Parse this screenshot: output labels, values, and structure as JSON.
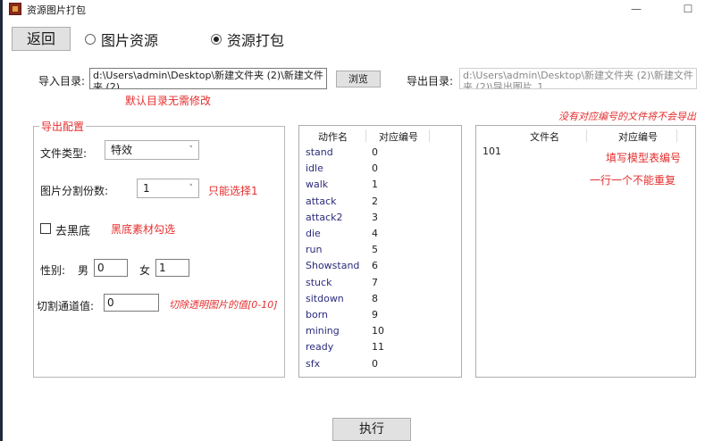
{
  "window": {
    "title": "资源图片打包",
    "minimize_glyph": "—",
    "maximize_glyph": "☐"
  },
  "top": {
    "back_label": "返回",
    "mode_options": [
      {
        "label": "图片资源",
        "selected": false
      },
      {
        "label": "资源打包",
        "selected": true
      }
    ]
  },
  "import": {
    "label": "导入目录:",
    "value": "d:\\Users\\admin\\Desktop\\新建文件夹 (2)\\新建文件夹 (2)",
    "browse_label": "浏览",
    "hint": "默认目录无需修改"
  },
  "export": {
    "label": "导出目录:",
    "value": "d:\\Users\\admin\\Desktop\\新建文件夹 (2)\\新建文件夹 (2)\\导出图片_1",
    "hint": "没有对应编号的文件将不会导出"
  },
  "config": {
    "group_title": "导出配置",
    "file_type_label": "文件类型:",
    "file_type_value": "特效",
    "split_label": "图片分割份数:",
    "split_value": "1",
    "split_hint": "只能选择1",
    "black_label": "去黑底",
    "black_checked": false,
    "black_hint": "黑底素材勾选",
    "gender_label": "性别:",
    "male_label": "男",
    "male_value": "0",
    "female_label": "女",
    "female_value": "1",
    "threshold_label": "切割通道值:",
    "threshold_value": "0",
    "threshold_hint": "切除透明图片的值[0-10]"
  },
  "actions": {
    "columns": [
      "动作名",
      "对应编号"
    ],
    "rows": [
      {
        "name": "stand",
        "code": "0"
      },
      {
        "name": "idle",
        "code": "0"
      },
      {
        "name": "walk",
        "code": "1"
      },
      {
        "name": "attack",
        "code": "2"
      },
      {
        "name": "attack2",
        "code": "3"
      },
      {
        "name": "die",
        "code": "4"
      },
      {
        "name": "run",
        "code": "5"
      },
      {
        "name": "Showstand",
        "code": "6"
      },
      {
        "name": "stuck",
        "code": "7"
      },
      {
        "name": "sitdown",
        "code": "8"
      },
      {
        "name": "born",
        "code": "9"
      },
      {
        "name": "mining",
        "code": "10"
      },
      {
        "name": "ready",
        "code": "11"
      },
      {
        "name": "sfx",
        "code": "0"
      }
    ]
  },
  "files": {
    "columns": [
      "文件名",
      "对应编号"
    ],
    "rows": [
      {
        "name": "101",
        "code": ""
      }
    ],
    "hint1": "填写模型表编号",
    "hint2": "一行一个不能重复"
  },
  "execute_label": "执行"
}
